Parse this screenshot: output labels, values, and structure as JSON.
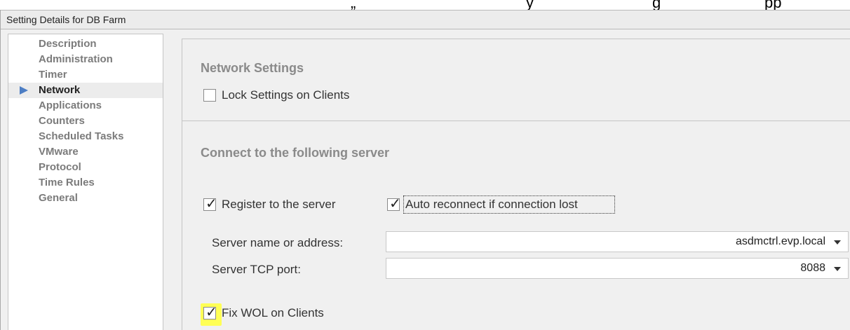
{
  "window": {
    "title": "Setting Details for DB Farm"
  },
  "sidebar": {
    "items": [
      {
        "label": "Description",
        "active": false
      },
      {
        "label": "Administration",
        "active": false
      },
      {
        "label": "Timer",
        "active": false
      },
      {
        "label": "Network",
        "active": true
      },
      {
        "label": "Applications",
        "active": false
      },
      {
        "label": "Counters",
        "active": false
      },
      {
        "label": "Scheduled Tasks",
        "active": false
      },
      {
        "label": "VMware",
        "active": false
      },
      {
        "label": "Protocol",
        "active": false
      },
      {
        "label": "Time Rules",
        "active": false
      },
      {
        "label": "General",
        "active": false
      }
    ]
  },
  "network_settings": {
    "title": "Network Settings",
    "lock_label": "Lock Settings on Clients",
    "lock_checked": false
  },
  "server": {
    "title": "Connect to the following server",
    "register_label": "Register to the server",
    "register_checked": true,
    "auto_reconnect_label": "Auto reconnect if connection lost",
    "auto_reconnect_checked": true,
    "name_label": "Server name or address:",
    "name_value": "asdmctrl.evp.local",
    "port_label": "Server TCP port:",
    "port_value": "8088",
    "fix_wol_label": "Fix WOL on Clients",
    "fix_wol_checked": true
  },
  "colors": {
    "highlight": "#ffff55",
    "active_arrow": "#4d7ec4",
    "section_title": "#8a8a8a"
  }
}
